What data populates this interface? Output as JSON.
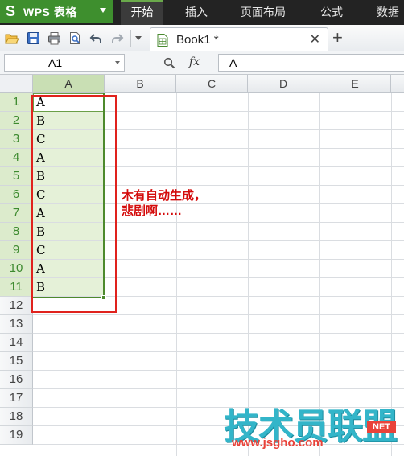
{
  "app": {
    "title": "WPS 表格",
    "logo_text": "S"
  },
  "ribbon": {
    "tabs": [
      {
        "label": "开始",
        "active": true
      },
      {
        "label": "插入",
        "active": false
      },
      {
        "label": "页面布局",
        "active": false
      },
      {
        "label": "公式",
        "active": false
      },
      {
        "label": "数据",
        "active": false
      }
    ]
  },
  "quick_access": {
    "icons": [
      "open-folder-icon",
      "save-icon",
      "print-icon",
      "print-preview-icon",
      "undo-icon",
      "redo-icon",
      "more-dropdown-icon"
    ]
  },
  "document_tab": {
    "name": "Book1 *",
    "close_glyph": "✕",
    "new_tab_glyph": "+"
  },
  "formula_bar": {
    "name_box": "A1",
    "fx_label": "fx",
    "formula": "A"
  },
  "grid": {
    "columns": [
      "A",
      "B",
      "C",
      "D",
      "E"
    ],
    "selected_column": "A",
    "rows": [
      "1",
      "2",
      "3",
      "4",
      "5",
      "6",
      "7",
      "8",
      "9",
      "10",
      "11",
      "12",
      "13",
      "14",
      "15",
      "16",
      "17",
      "18",
      "19"
    ],
    "selected_rows": [
      "1",
      "2",
      "3",
      "4",
      "5",
      "6",
      "7",
      "8",
      "9",
      "10",
      "11"
    ],
    "column_a_values": [
      "A",
      "B",
      "C",
      "A",
      "B",
      "C",
      "A",
      "B",
      "C",
      "A",
      "B"
    ]
  },
  "annotation": {
    "line1": "木有自动生成，",
    "line2": "悲剧啊……"
  },
  "watermark": {
    "text": "技术员联盟",
    "url": "www.jsgho.com",
    "com_badge": "NET"
  },
  "colors": {
    "accent_green": "#3e8f2e",
    "selection_border": "#4d8a2c",
    "selection_fill": "#e5f1d8",
    "annotation_red": "#e0221d",
    "watermark_blue": "#33b5c9"
  }
}
